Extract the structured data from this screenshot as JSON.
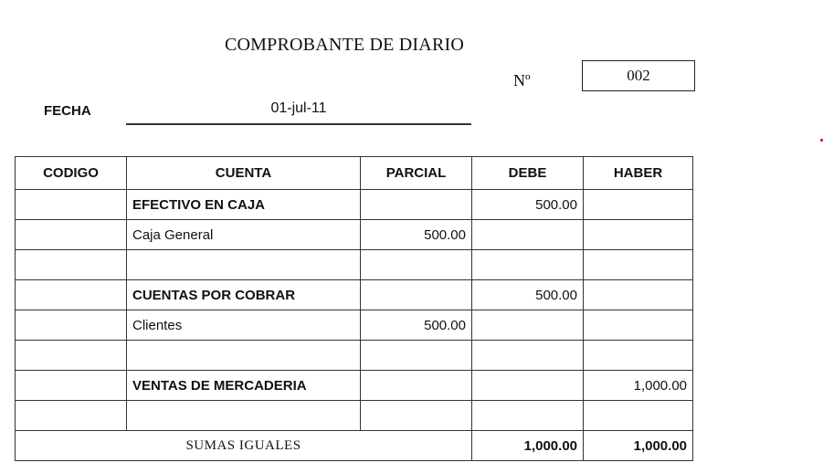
{
  "header": {
    "title": "COMPROBANTE DE DIARIO",
    "number_label": "Nº",
    "number_value": "002",
    "date_label": "FECHA",
    "date_value": "01-jul-11"
  },
  "table": {
    "columns": [
      "CODIGO",
      "CUENTA",
      "PARCIAL",
      "DEBE",
      "HABER"
    ],
    "rows": [
      {
        "codigo": "",
        "cuenta": "EFECTIVO EN CAJA",
        "parcial": "",
        "debe": "500.00",
        "haber": ""
      },
      {
        "codigo": "",
        "cuenta": "Caja General",
        "parcial": "500.00",
        "debe": "",
        "haber": ""
      },
      {
        "codigo": "",
        "cuenta": "",
        "parcial": "",
        "debe": "",
        "haber": ""
      },
      {
        "codigo": "",
        "cuenta": "CUENTAS POR COBRAR",
        "parcial": "",
        "debe": "500.00",
        "haber": ""
      },
      {
        "codigo": "",
        "cuenta": "Clientes",
        "parcial": "500.00",
        "debe": "",
        "haber": ""
      },
      {
        "codigo": "",
        "cuenta": "",
        "parcial": "",
        "debe": "",
        "haber": ""
      },
      {
        "codigo": "",
        "cuenta": "VENTAS DE MERCADERIA",
        "parcial": "",
        "debe": "",
        "haber": "1,000.00"
      },
      {
        "codigo": "",
        "cuenta": "",
        "parcial": "",
        "debe": "",
        "haber": ""
      }
    ],
    "totals": {
      "label": "SUMAS IGUALES",
      "debe": "1,000.00",
      "haber": "1,000.00"
    }
  }
}
